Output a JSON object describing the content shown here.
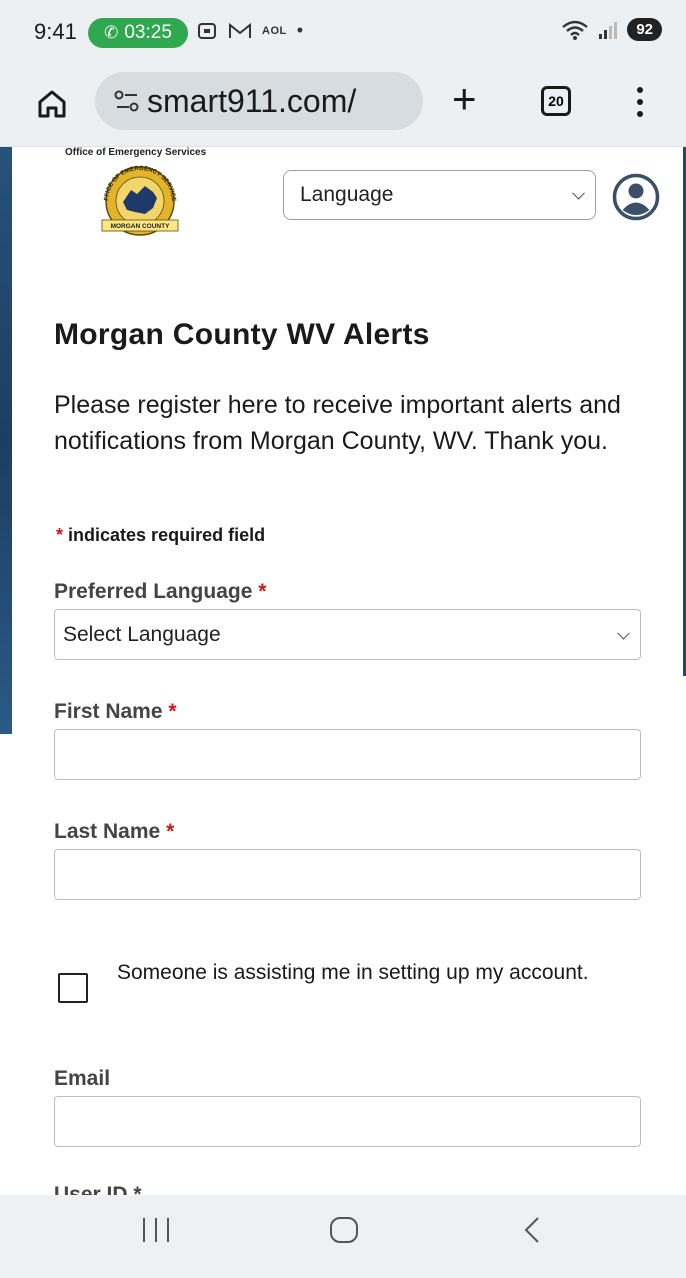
{
  "status_bar": {
    "time": "9:41",
    "call_timer": "03:25",
    "aol_label": "AOL",
    "dot": "•",
    "battery": "92",
    "icons": [
      "phone-icon",
      "screenshot-icon",
      "gmail-icon",
      "wifi-icon",
      "signal-icon"
    ]
  },
  "browser": {
    "url": "smart911.com/",
    "tab_count": "20",
    "icons": [
      "home-icon",
      "site-settings-icon",
      "new-tab-icon",
      "tab-switcher-icon",
      "more-menu-icon"
    ]
  },
  "header": {
    "office_label": "Office of Emergency Services",
    "seal_text": "OFFICE OF EMERGENCY SERVICES",
    "seal_banner": "MORGAN COUNTY",
    "language_select": "Language"
  },
  "content": {
    "title": "Morgan County WV Alerts",
    "intro": "Please register here to receive important alerts and notifications from Morgan County, WV. Thank you.",
    "required_star": "*",
    "required_note": "indicates required field"
  },
  "form": {
    "preferred_language_label": "Preferred Language",
    "preferred_language_value": "Select Language",
    "first_name_label": "First Name",
    "last_name_label": "Last Name",
    "assist_label": "Someone is assisting me in setting up my account.",
    "email_label": "Email",
    "next_label_partial": "User ID *"
  },
  "colors": {
    "required": "#d31717",
    "call_pill": "#2fa84f",
    "account_icon": "#3b4f66"
  }
}
